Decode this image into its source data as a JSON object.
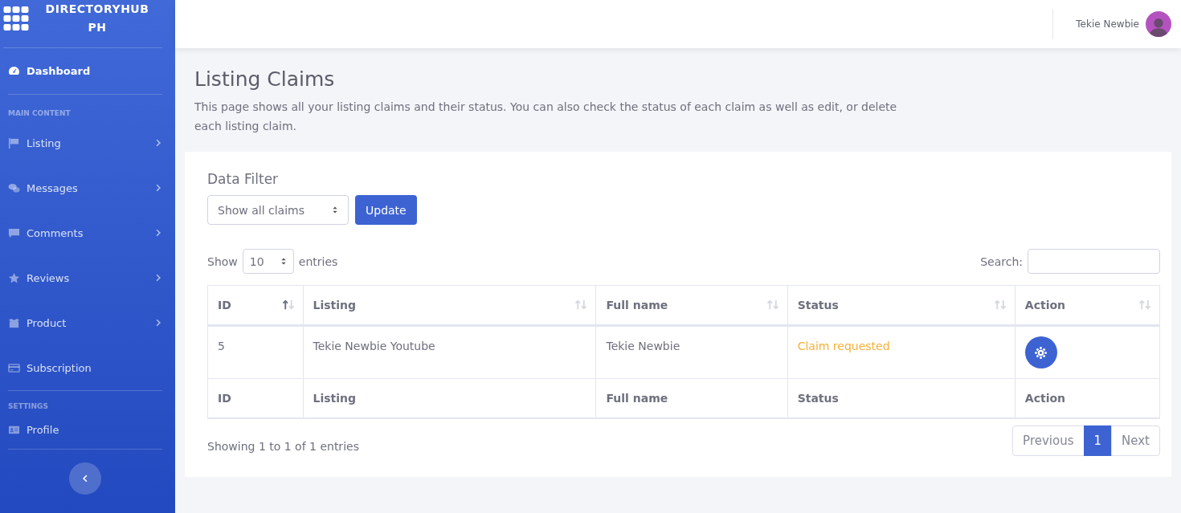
{
  "brand": {
    "title": "DIRECTORYHUB PH"
  },
  "sidebar": {
    "sections": [
      {
        "items": [
          {
            "label": "Dashboard",
            "selected": true,
            "expandable": false
          }
        ]
      },
      {
        "heading": "MAIN CONTENT",
        "items": [
          {
            "label": "Listing",
            "selected": false,
            "expandable": true
          },
          {
            "label": "Messages",
            "selected": false,
            "expandable": true
          },
          {
            "label": "Comments",
            "selected": false,
            "expandable": true
          },
          {
            "label": "Reviews",
            "selected": false,
            "expandable": true
          },
          {
            "label": "Product",
            "selected": false,
            "expandable": true
          },
          {
            "label": "Subscription",
            "selected": false,
            "expandable": false
          }
        ]
      },
      {
        "heading": "SETTINGS",
        "items": [
          {
            "label": "Profile",
            "selected": false,
            "expandable": false
          }
        ]
      }
    ]
  },
  "topbar": {
    "user_name": "Tekie Newbie"
  },
  "page": {
    "title": "Listing Claims",
    "description": "This page shows all your listing claims and their status. You can also check the status of each claim as well as edit, or delete each listing claim."
  },
  "filter": {
    "title": "Data Filter",
    "select_value": "Show all claims",
    "button": "Update"
  },
  "table": {
    "show_label": "Show",
    "entries_value": "10",
    "entries_label": "entries",
    "search_label": "Search:",
    "columns": [
      {
        "label": "ID",
        "sorted": true
      },
      {
        "label": "Listing",
        "sorted": false
      },
      {
        "label": "Full name",
        "sorted": false
      },
      {
        "label": "Status",
        "sorted": false
      },
      {
        "label": "Action",
        "sorted": false
      }
    ],
    "rows": [
      {
        "id": "5",
        "listing": "Tekie Newbie Youtube",
        "full_name": "Tekie Newbie",
        "status": "Claim requested",
        "color": "#f6b035"
      }
    ],
    "footer": [
      "ID",
      "Listing",
      "Full name",
      "Status",
      "Action"
    ],
    "info": "Showing 1 to 1 of 1 entries",
    "pagination": [
      {
        "label": "Previous",
        "selected": false
      },
      {
        "label": "1",
        "selected": true
      },
      {
        "label": "Next",
        "selected": false
      }
    ]
  }
}
